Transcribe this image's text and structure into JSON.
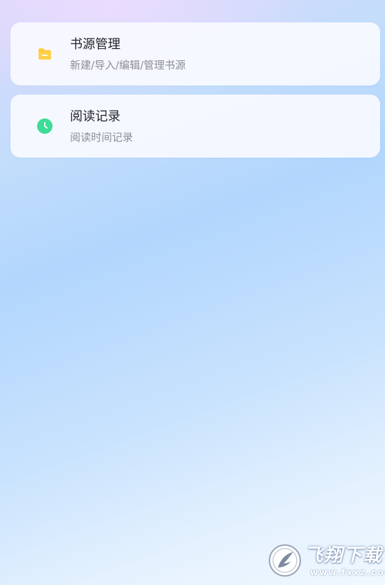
{
  "menu": {
    "items": [
      {
        "title": "书源管理",
        "subtitle": "新建/导入/编辑/管理书源",
        "icon": "folder-icon",
        "icon_color": "#FFC93C"
      },
      {
        "title": "阅读记录",
        "subtitle": "阅读时间记录",
        "icon": "clock-icon",
        "icon_color": "#3DDC97"
      }
    ]
  },
  "watermark": {
    "title": "飞翔下载",
    "site": "www.fxxz.com"
  }
}
